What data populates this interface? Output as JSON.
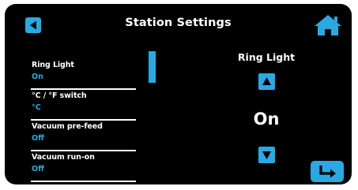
{
  "header": {
    "title": "Station Settings",
    "back_icon": "back-arrow-icon",
    "home_icon": "home-icon"
  },
  "settings": [
    {
      "name": "Ring Light",
      "value": "On"
    },
    {
      "name": "°C / °F switch",
      "value": "°C"
    },
    {
      "name": "Vacuum pre-feed",
      "value": "Off"
    },
    {
      "name": "Vacuum run-on",
      "value": "Off"
    }
  ],
  "detail": {
    "title": "Ring Light",
    "value": "On",
    "up_icon": "arrow-up-icon",
    "down_icon": "arrow-down-icon",
    "enter_icon": "enter-icon"
  },
  "colors": {
    "accent": "#29a9e1",
    "background": "#000000",
    "text": "#ffffff"
  }
}
